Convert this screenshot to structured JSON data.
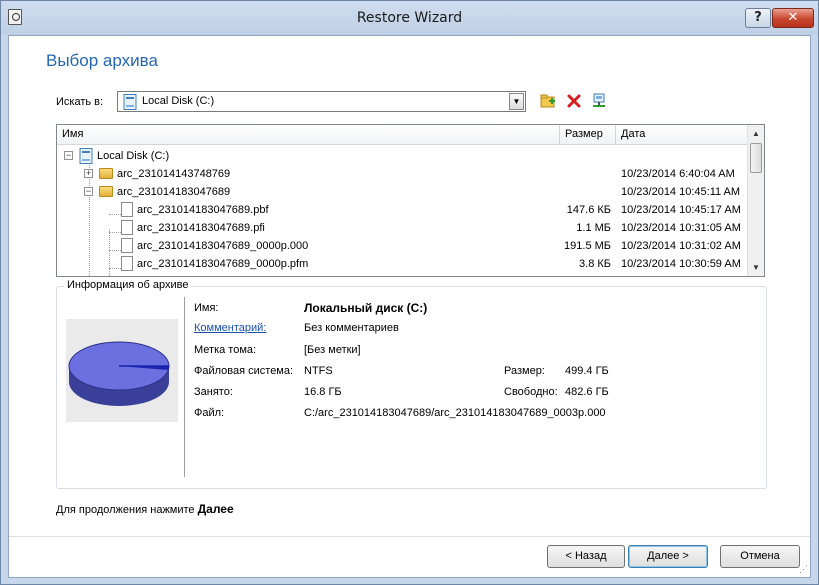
{
  "window": {
    "title": "Restore Wizard",
    "help_label": "?",
    "close_label": "✕"
  },
  "page_title": "Выбор архива",
  "search": {
    "label": "Искать в:",
    "value": "Local Disk (C:)",
    "arrow": "▼"
  },
  "tree": {
    "columns": [
      "Имя",
      "Размер",
      "Дата"
    ],
    "rows": [
      {
        "name": "Local Disk (C:)",
        "size": "",
        "date": ""
      },
      {
        "name": "arc_231014143748769",
        "size": "",
        "date": "10/23/2014 6:40:04 AM"
      },
      {
        "name": "arc_231014183047689",
        "size": "",
        "date": "10/23/2014 10:45:11 AM"
      },
      {
        "name": "arc_231014183047689.pbf",
        "size": "147.6 КБ",
        "date": "10/23/2014 10:45:17 AM"
      },
      {
        "name": "arc_231014183047689.pfi",
        "size": "1.1 МБ",
        "date": "10/23/2014 10:31:05 AM"
      },
      {
        "name": "arc_231014183047689_0000p.000",
        "size": "191.5 МБ",
        "date": "10/23/2014 10:31:02 AM"
      },
      {
        "name": "arc_231014183047689_0000p.pfm",
        "size": "3.8 КБ",
        "date": "10/23/2014 10:30:59 AM"
      }
    ],
    "scroll_up": "▲",
    "scroll_down": "▼"
  },
  "info": {
    "group_title": "Информация об архиве",
    "name_label": "Имя:",
    "name_value": "Локальный диск (C:)",
    "comment_label": "Комментарий:",
    "comment_value": "Без комментариев",
    "volume_label": "Метка тома:",
    "volume_value": "[Без метки]",
    "fs_label": "Файловая система:",
    "fs_value": "NTFS",
    "size_label": "Размер:",
    "size_value": "499.4 ГБ",
    "used_label": "Занято:",
    "used_value": "16.8 ГБ",
    "free_label": "Свободно:",
    "free_value": "482.6 ГБ",
    "file_label": "Файл:",
    "file_value": "C:/arc_231014183047689/arc_231014183047689_0003p.000"
  },
  "hint": {
    "text": "Для продолжения нажмите ",
    "bold": "Далее"
  },
  "buttons": {
    "back": "< Назад",
    "next": "Далее >",
    "cancel": "Отмена"
  },
  "colors": {
    "accent": "#2566b4",
    "pie_fill": "#6b6fe0",
    "pie_used": "#1a23b0"
  }
}
